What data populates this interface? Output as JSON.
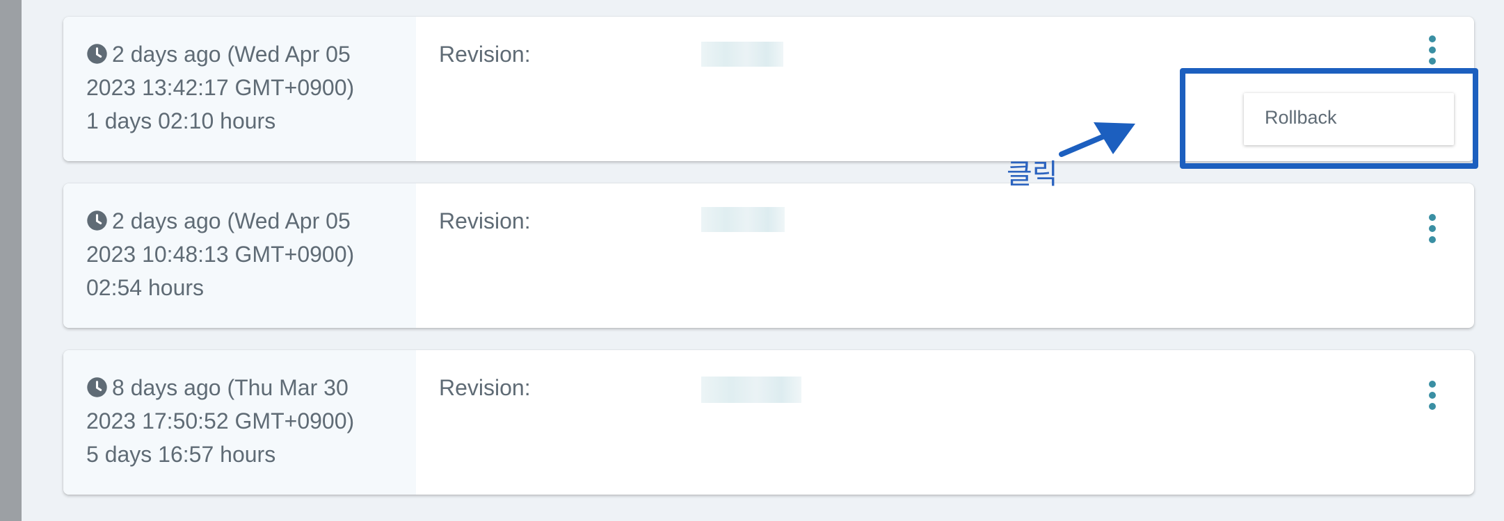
{
  "revisions": [
    {
      "relative": "2 days ago",
      "datetime": "(Wed Apr 05 2023 13:42:17 GMT+0900)",
      "duration": "1 days 02:10 hours",
      "revision_label": "Revision:"
    },
    {
      "relative": "2 days ago",
      "datetime": "(Wed Apr 05 2023 10:48:13 GMT+0900)",
      "duration": "02:54 hours",
      "revision_label": "Revision:"
    },
    {
      "relative": "8 days ago",
      "datetime": "(Thu Mar 30 2023 17:50:52 GMT+0900)",
      "duration": "5 days 16:57 hours",
      "revision_label": "Revision:"
    }
  ],
  "dropdown": {
    "items": [
      "Rollback"
    ]
  },
  "annotation": {
    "text": "클릭",
    "color": "#1c5fbf"
  },
  "colors": {
    "accent": "#3a8fa3",
    "text": "#5f6b75",
    "background": "#eef2f6"
  }
}
